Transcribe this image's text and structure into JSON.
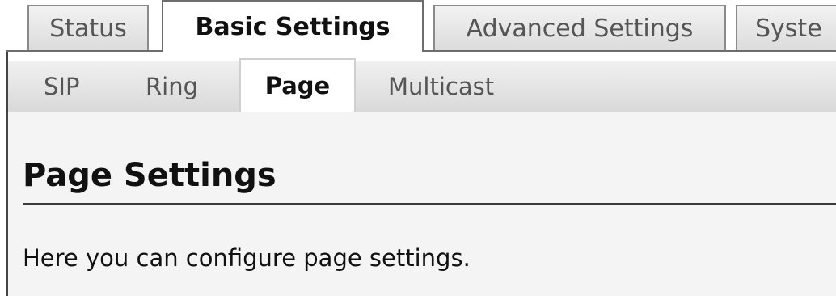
{
  "top_tabs": [
    {
      "label": "Status",
      "active": false
    },
    {
      "label": "Basic Settings",
      "active": true
    },
    {
      "label": "Advanced Settings",
      "active": false
    },
    {
      "label": "Syste",
      "active": false
    }
  ],
  "sub_tabs": [
    {
      "label": "SIP",
      "active": false
    },
    {
      "label": "Ring",
      "active": false
    },
    {
      "label": "Page",
      "active": true
    },
    {
      "label": "Multicast",
      "active": false
    }
  ],
  "content": {
    "title": "Page Settings",
    "description": "Here you can configure page settings."
  },
  "colors": {
    "tab_border": "#8a8a8a",
    "active_tab_bg": "#ffffff",
    "subbar_bg": "#dcdcdc",
    "content_bg": "#f4f4f4",
    "text": "#111111",
    "muted_text": "#555555"
  }
}
